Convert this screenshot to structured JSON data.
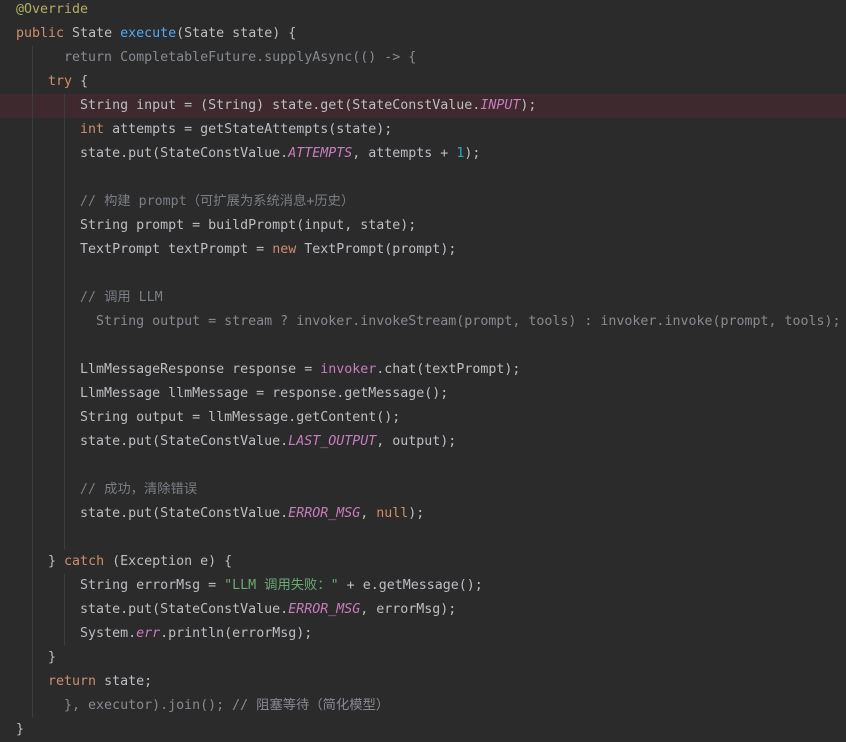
{
  "editor": {
    "theme": {
      "background": "#2b2b2b",
      "highlight_line": "#3e2a2e",
      "indent_guide": "#3c3d40",
      "plain": "#bcbec4",
      "keyword": "#cf8e6d",
      "method": "#56a8f5",
      "annotation": "#b3ae60",
      "static_field": "#c77dbb",
      "field": "#c77dbb",
      "number": "#2aacb8",
      "string": "#6aab73",
      "comment": "#7a7e85",
      "dim": "#868a91"
    },
    "lines": [
      {
        "tokens": [
          {
            "annotation": "@Override"
          }
        ]
      },
      {
        "tokens": [
          {
            "keyword": "public"
          },
          {
            "plain": " State "
          },
          {
            "method": "execute"
          },
          {
            "plain": "(State state) {"
          }
        ]
      },
      {
        "tokens": [
          {
            "dim": "      return CompletableFuture.supplyAsync(() -> {"
          }
        ]
      },
      {
        "tokens": [
          {
            "plain": "    "
          },
          {
            "keyword": "try"
          },
          {
            "plain": " {"
          }
        ]
      },
      {
        "highlighted": true,
        "tokens": [
          {
            "plain": "        String input = (String) state.get(StateConstValue."
          },
          {
            "static_field": "INPUT"
          },
          {
            "plain": ");"
          }
        ]
      },
      {
        "tokens": [
          {
            "plain": "        "
          },
          {
            "keyword": "int"
          },
          {
            "plain": " attempts = getStateAttempts(state);"
          }
        ]
      },
      {
        "tokens": [
          {
            "plain": "        state.put(StateConstValue."
          },
          {
            "static_field": "ATTEMPTS"
          },
          {
            "plain": ", attempts + "
          },
          {
            "number": "1"
          },
          {
            "plain": ");"
          }
        ]
      },
      {
        "tokens": []
      },
      {
        "tokens": [
          {
            "plain": "        "
          },
          {
            "comment": "// 构建 prompt（可扩展为系统消息+历史）"
          }
        ]
      },
      {
        "tokens": [
          {
            "plain": "        String prompt = buildPrompt(input, state);"
          }
        ]
      },
      {
        "tokens": [
          {
            "plain": "        TextPrompt textPrompt = "
          },
          {
            "keyword": "new"
          },
          {
            "plain": " TextPrompt(prompt);"
          }
        ]
      },
      {
        "tokens": []
      },
      {
        "tokens": [
          {
            "plain": "        "
          },
          {
            "comment": "// 调用 LLM"
          }
        ]
      },
      {
        "tokens": [
          {
            "dim": "          String output = stream ? invoker.invokeStream(prompt, tools) : invoker.invoke(prompt, tools);"
          }
        ]
      },
      {
        "tokens": []
      },
      {
        "tokens": [
          {
            "plain": "        LlmMessageResponse response = "
          },
          {
            "field": "invoker"
          },
          {
            "plain": ".chat(textPrompt);"
          }
        ]
      },
      {
        "tokens": [
          {
            "plain": "        LlmMessage llmMessage = response.getMessage();"
          }
        ]
      },
      {
        "tokens": [
          {
            "plain": "        String output = llmMessage.getContent();"
          }
        ]
      },
      {
        "tokens": [
          {
            "plain": "        state.put(StateConstValue."
          },
          {
            "static_field": "LAST_OUTPUT"
          },
          {
            "plain": ", output);"
          }
        ]
      },
      {
        "tokens": []
      },
      {
        "tokens": [
          {
            "plain": "        "
          },
          {
            "comment": "// 成功，清除错误"
          }
        ]
      },
      {
        "tokens": [
          {
            "plain": "        state.put(StateConstValue."
          },
          {
            "static_field": "ERROR_MSG"
          },
          {
            "plain": ", "
          },
          {
            "keyword": "null"
          },
          {
            "plain": ");"
          }
        ]
      },
      {
        "tokens": []
      },
      {
        "tokens": [
          {
            "plain": "    } "
          },
          {
            "keyword": "catch"
          },
          {
            "plain": " (Exception e) {"
          }
        ]
      },
      {
        "tokens": [
          {
            "plain": "        String errorMsg = "
          },
          {
            "string": "\"LLM 调用失败：\""
          },
          {
            "plain": " + e.getMessage();"
          }
        ]
      },
      {
        "tokens": [
          {
            "plain": "        state.put(StateConstValue."
          },
          {
            "static_field": "ERROR_MSG"
          },
          {
            "plain": ", errorMsg);"
          }
        ]
      },
      {
        "tokens": [
          {
            "plain": "        System."
          },
          {
            "static_field": "err"
          },
          {
            "plain": ".println(errorMsg);"
          }
        ]
      },
      {
        "tokens": [
          {
            "plain": "    }"
          }
        ]
      },
      {
        "tokens": [
          {
            "plain": "    "
          },
          {
            "keyword": "return"
          },
          {
            "plain": " state;"
          }
        ]
      },
      {
        "tokens": [
          {
            "dim": "      }, executor).join(); // 阻塞等待（简化模型）"
          }
        ]
      },
      {
        "tokens": [
          {
            "plain": "}"
          }
        ]
      }
    ]
  }
}
